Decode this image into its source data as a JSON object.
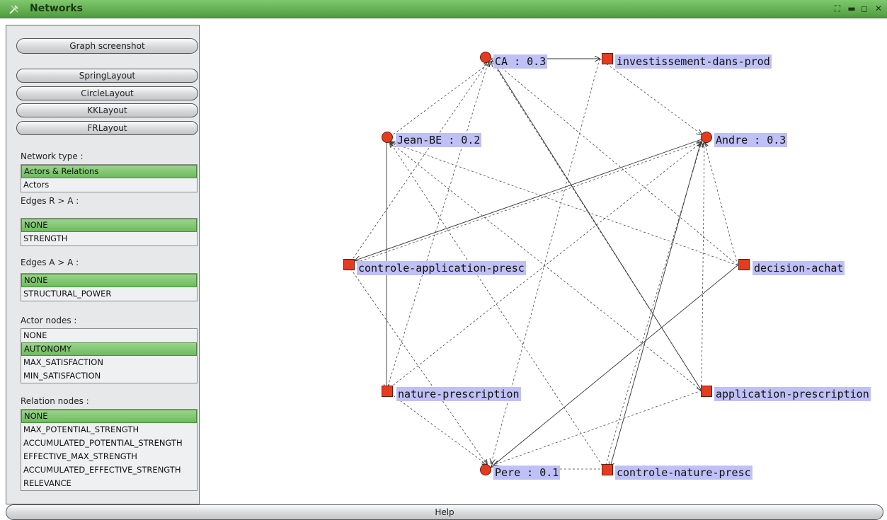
{
  "window": {
    "title": "Networks",
    "controls": [
      "⛶",
      "▬",
      "◻",
      "✕"
    ]
  },
  "buttons": {
    "screenshot": "Graph screenshot",
    "layouts": [
      "SpringLayout",
      "CircleLayout",
      "KKLayout",
      "FRLayout"
    ],
    "help": "Help"
  },
  "options": {
    "network_type": {
      "label": "Network type :",
      "items": [
        "Actors & Relations",
        "Actors"
      ],
      "selected": 0
    },
    "edges_ra": {
      "label": "Edges R > A :",
      "items": [
        "NONE",
        "STRENGTH"
      ],
      "selected": 0
    },
    "edges_aa": {
      "label": "Edges A > A :",
      "items": [
        "NONE",
        "STRUCTURAL_POWER"
      ],
      "selected": 0
    },
    "actor_nodes": {
      "label": "Actor nodes :",
      "items": [
        "NONE",
        "AUTONOMY",
        "MAX_SATISFACTION",
        "MIN_SATISFACTION"
      ],
      "selected": 1
    },
    "relation_nodes": {
      "label": "Relation nodes :",
      "items": [
        "NONE",
        "MAX_POTENTIAL_STRENGTH",
        "ACCUMULATED_POTENTIAL_STRENGTH",
        "EFFECTIVE_MAX_STRENGTH",
        "ACCUMULATED_EFFECTIVE_STRENGTH",
        "RELEVANCE"
      ],
      "selected": 0
    }
  },
  "graph": {
    "nodes": [
      {
        "id": "CA",
        "label": "CA : 0.3",
        "shape": "circle"
      },
      {
        "id": "inv",
        "label": "investissement-dans-prod",
        "shape": "square"
      },
      {
        "id": "Andre",
        "label": "Andre : 0.3",
        "shape": "circle"
      },
      {
        "id": "dec",
        "label": "decision-achat",
        "shape": "square"
      },
      {
        "id": "app",
        "label": "application-prescription",
        "shape": "square"
      },
      {
        "id": "cnp",
        "label": "controle-nature-presc",
        "shape": "square"
      },
      {
        "id": "Pere",
        "label": "Pere : 0.1",
        "shape": "circle"
      },
      {
        "id": "np",
        "label": "nature-prescription",
        "shape": "square"
      },
      {
        "id": "cap",
        "label": "controle-application-presc",
        "shape": "square"
      },
      {
        "id": "Jean",
        "label": "Jean-BE : 0.2",
        "shape": "circle"
      }
    ],
    "colors": {
      "node": "#e63b1f",
      "label_bg": "#bfc0f6",
      "selected": "#7cc46b"
    }
  }
}
